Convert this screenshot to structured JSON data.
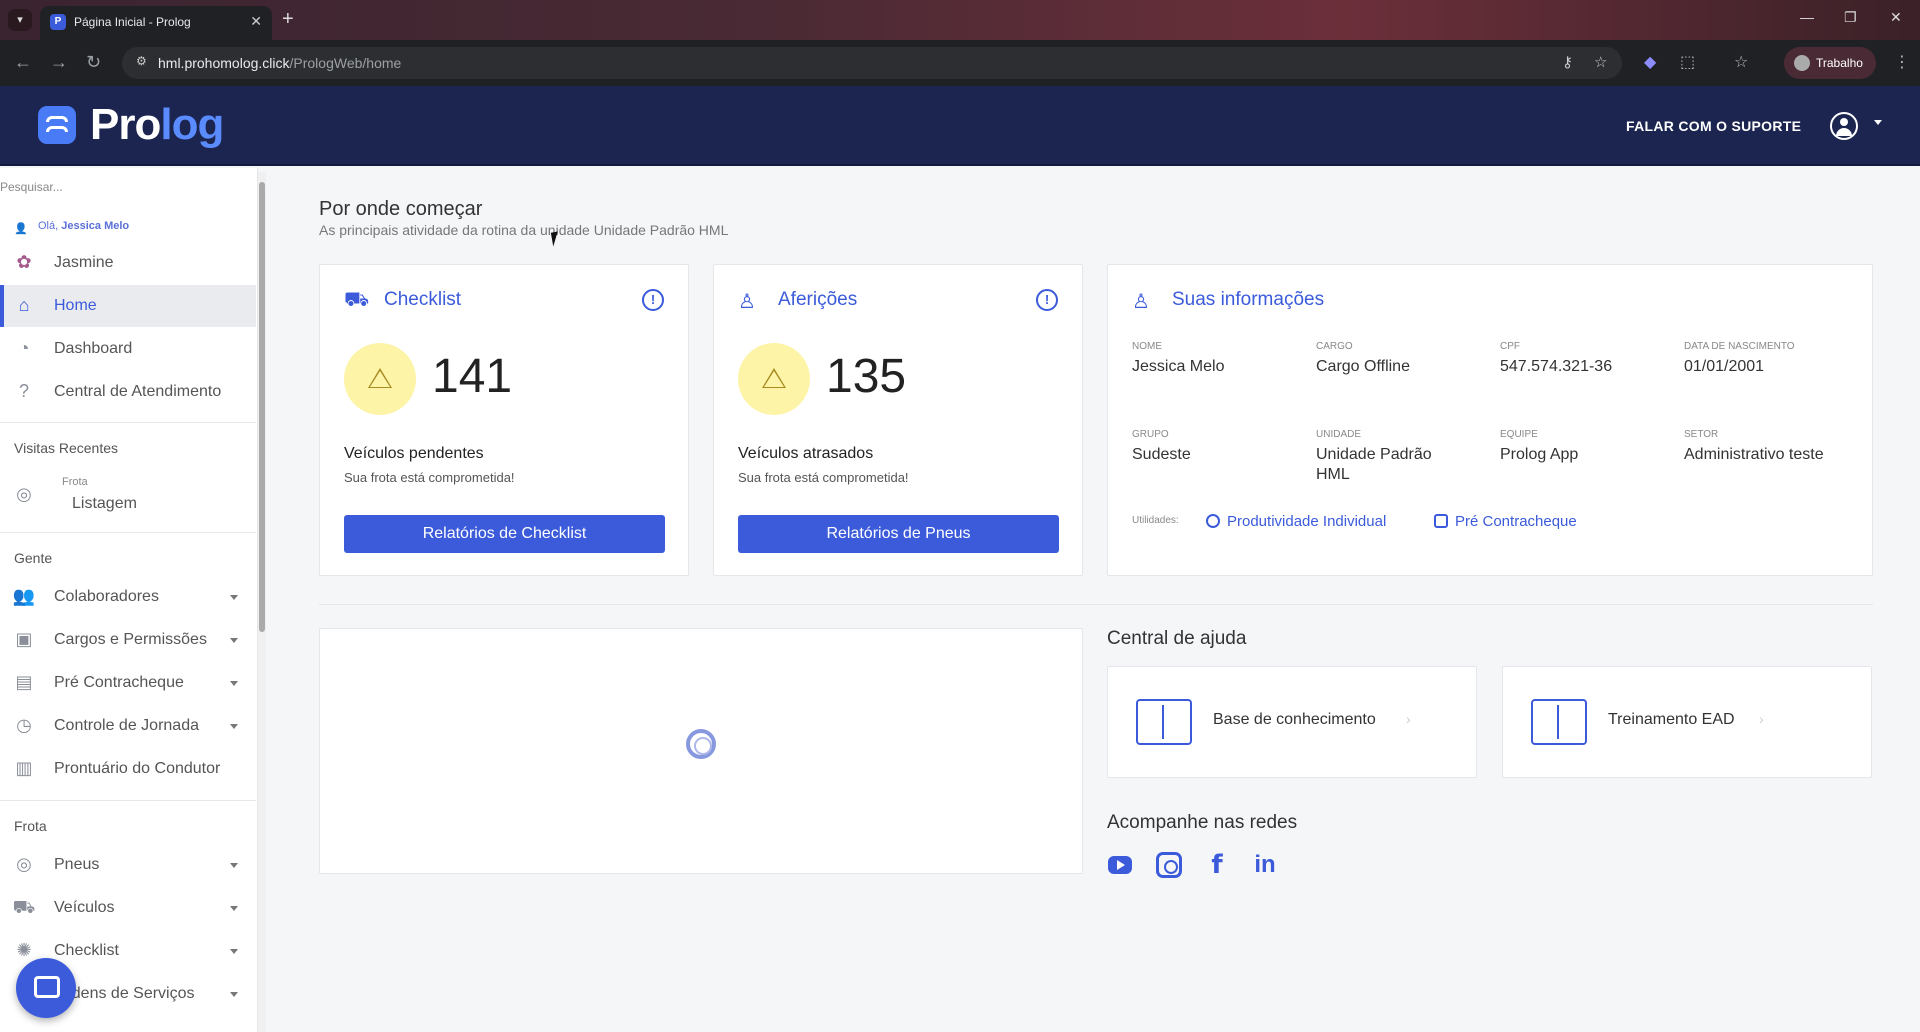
{
  "browser": {
    "tab_title": "Página Inicial - Prolog",
    "url_host": "hml.prohomolog.click",
    "url_path": "/PrologWeb/home",
    "profile": "Trabalho"
  },
  "header": {
    "logo_pro": "Pro",
    "logo_log": "log",
    "support": "FALAR COM O SUPORTE"
  },
  "sidebar": {
    "search_placeholder": "Pesquisar...",
    "hello_prefix": "Olá,",
    "user_name": "Jessica Melo",
    "company": "Jasmine",
    "top_items": [
      {
        "label": "Home",
        "icon": "home-icon"
      },
      {
        "label": "Dashboard",
        "icon": "dashboard-icon"
      },
      {
        "label": "Central de Atendimento",
        "icon": "help-icon"
      }
    ],
    "recent_title": "Visitas Recentes",
    "recent_sub": "Frota",
    "recent_label": "Listagem",
    "gente_title": "Gente",
    "gente_items": [
      {
        "label": "Colaboradores"
      },
      {
        "label": "Cargos e Permissões"
      },
      {
        "label": "Pré Contracheque"
      },
      {
        "label": "Controle de Jornada"
      },
      {
        "label": "Prontuário do Condutor"
      }
    ],
    "frota_title": "Frota",
    "frota_items": [
      {
        "label": "Pneus"
      },
      {
        "label": "Veículos"
      },
      {
        "label": "Checklist"
      },
      {
        "label": "Ordens de Serviços"
      }
    ]
  },
  "main": {
    "title": "Por onde começar",
    "subtitle": "As principais atividade da rotina da unidade Unidade Padrão HML",
    "checklist": {
      "title": "Checklist",
      "count": "141",
      "label": "Veículos pendentes",
      "sub": "Sua frota está comprometida!",
      "button": "Relatórios de Checklist"
    },
    "afericoes": {
      "title": "Aferições",
      "count": "135",
      "label": "Veículos atrasados",
      "sub": "Sua frota está comprometida!",
      "button": "Relatórios de Pneus"
    },
    "info": {
      "title": "Suas informações",
      "fields": [
        {
          "label": "NOME",
          "value": "Jessica Melo"
        },
        {
          "label": "CARGO",
          "value": "Cargo Offline"
        },
        {
          "label": "CPF",
          "value": "547.574.321-36"
        },
        {
          "label": "DATA DE NASCIMENTO",
          "value": "01/01/2001"
        },
        {
          "label": "GRUPO",
          "value": "Sudeste"
        },
        {
          "label": "UNIDADE",
          "value": "Unidade Padrão HML"
        },
        {
          "label": "EQUIPE",
          "value": "Prolog App"
        },
        {
          "label": "SETOR",
          "value": "Administrativo teste"
        }
      ],
      "utilities_label": "Utilidades:",
      "util_1": "Produtividade Individual",
      "util_2": "Pré Contracheque"
    },
    "help_title": "Central de ajuda",
    "help_1": "Base de conhecimento",
    "help_2": "Treinamento EAD",
    "social_title": "Acompanhe nas redes",
    "fb": "f",
    "li": "in"
  }
}
